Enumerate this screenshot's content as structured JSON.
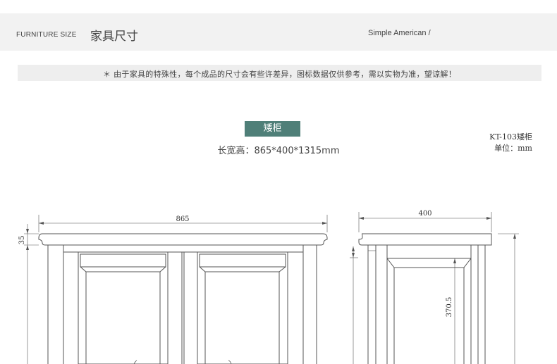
{
  "header": {
    "section_en": "FURNITURE SIZE",
    "section_cn": "家具尺寸",
    "style_label": "Simple American /"
  },
  "notice": {
    "text": "＊ 由于家具的特殊性，每个成品的尺寸会有些许差异，图标数据仅供参考，需以实物为准，望谅解！"
  },
  "product": {
    "name": "矮柜",
    "dimensions": "长宽高：865*400*1315mm",
    "model": "KT-103矮柜",
    "unit": "单位：mm"
  },
  "drawing": {
    "front_width": "865",
    "top_thickness": "35",
    "side_depth": "400",
    "side_height": "370.5"
  },
  "colors": {
    "badge": "#4f7f78",
    "header_bg": "#f2f2f2",
    "notice_bg": "#eeeeee",
    "line": "#555555"
  }
}
